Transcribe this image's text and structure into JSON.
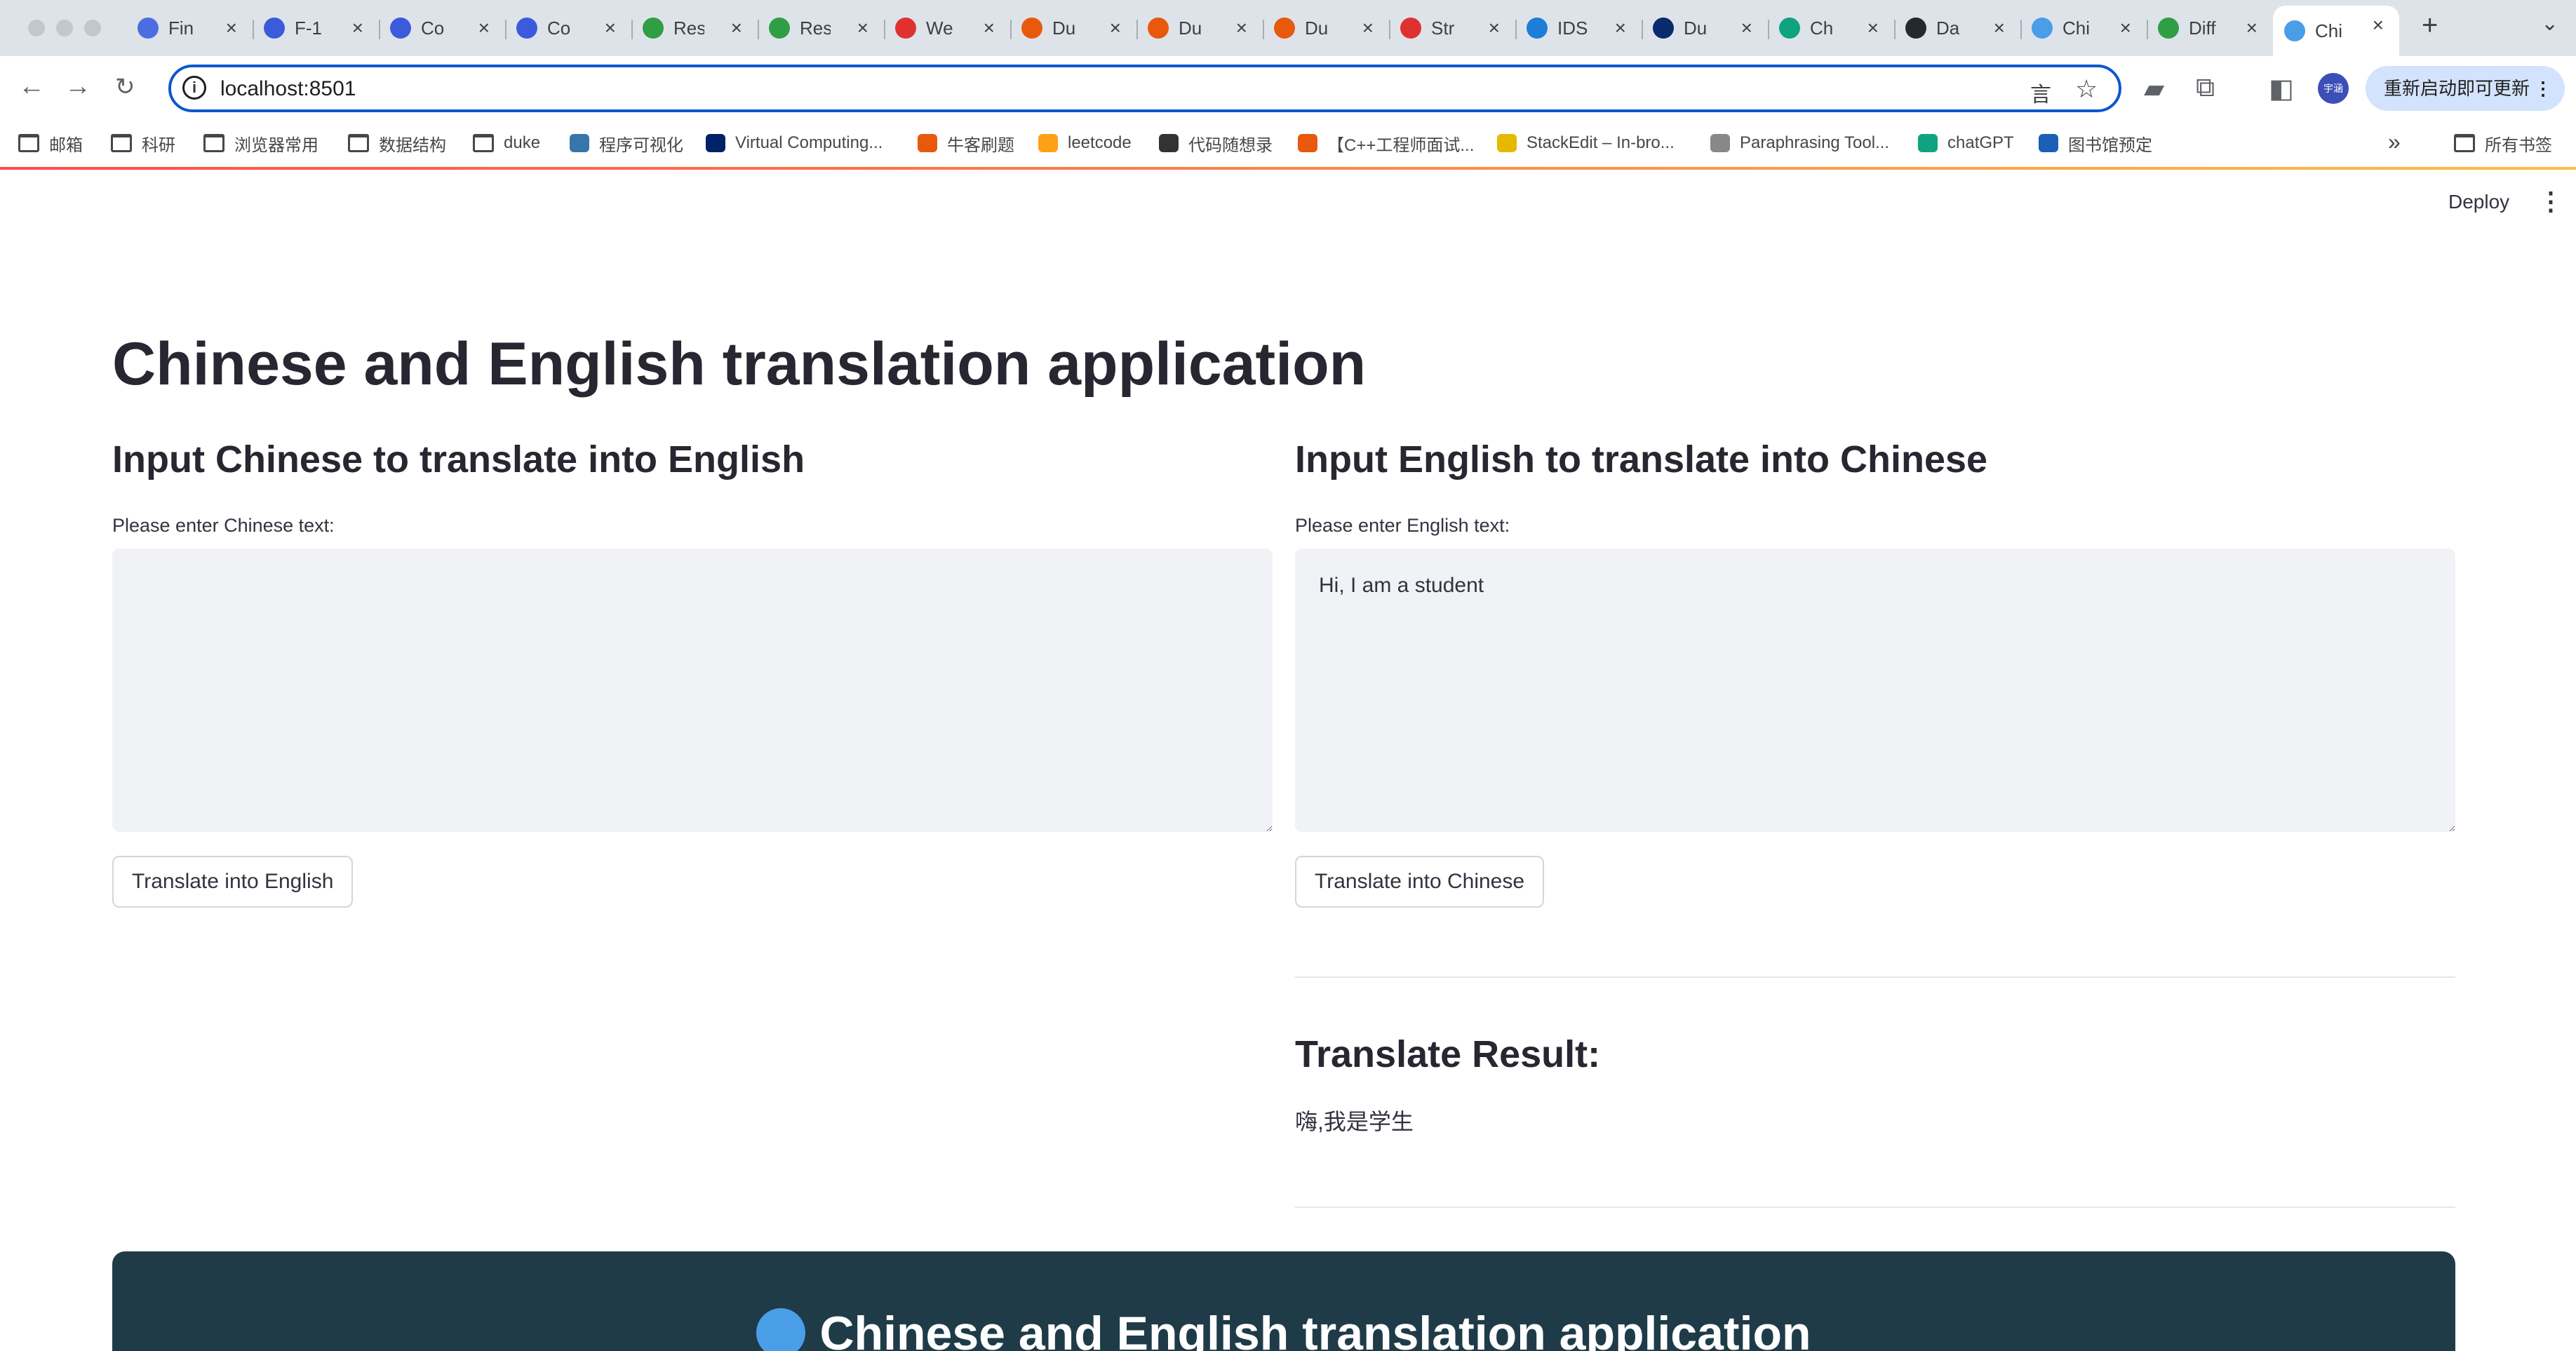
{
  "browser": {
    "tabs": [
      {
        "label": "Fin",
        "favicon": "globe-icon",
        "color": "#4a6ee0"
      },
      {
        "label": "F-1",
        "favicon": "target-icon",
        "color": "#3b5bdb"
      },
      {
        "label": "Co",
        "favicon": "course-icon",
        "color": "#3b5bdb"
      },
      {
        "label": "Co",
        "favicon": "course-icon",
        "color": "#3b5bdb"
      },
      {
        "label": "Res",
        "favicon": "bird-icon",
        "color": "#2f9e44"
      },
      {
        "label": "Res",
        "favicon": "bird-icon",
        "color": "#2f9e44"
      },
      {
        "label": "We",
        "favicon": "web-icon",
        "color": "#e03131"
      },
      {
        "label": "Du",
        "favicon": "gitlab-icon",
        "color": "#e8590c"
      },
      {
        "label": "Du",
        "favicon": "gitlab-icon",
        "color": "#e8590c"
      },
      {
        "label": "Du",
        "favicon": "gitlab-icon",
        "color": "#e8590c"
      },
      {
        "label": "Str",
        "favicon": "streamlit-icon",
        "color": "#e03131"
      },
      {
        "label": "IDS",
        "favicon": "doc-icon",
        "color": "#1c7ed6"
      },
      {
        "label": "Du",
        "favicon": "duke-icon",
        "color": "#0b2a6e"
      },
      {
        "label": "Ch",
        "favicon": "chatgpt-icon",
        "color": "#10a37f"
      },
      {
        "label": "Da",
        "favicon": "github-icon",
        "color": "#24292f"
      },
      {
        "label": "Chi",
        "favicon": "globe-icon",
        "color": "#4a9ee8"
      },
      {
        "label": "Diff",
        "favicon": "diff-icon",
        "color": "#2f9e44"
      },
      {
        "label": "Chi",
        "favicon": "globe-icon",
        "color": "#4a9ee8"
      }
    ],
    "url": "localhost:8501",
    "update_button": "重新启动即可更新",
    "profile": "宇涵"
  },
  "bookmarks": [
    {
      "label": "邮箱",
      "icon": "folder-icon"
    },
    {
      "label": "科研",
      "icon": "folder-icon"
    },
    {
      "label": "浏览器常用",
      "icon": "folder-icon"
    },
    {
      "label": "数据结构",
      "icon": "folder-icon"
    },
    {
      "label": "duke",
      "icon": "folder-icon"
    },
    {
      "label": "程序可视化",
      "icon": "python-icon"
    },
    {
      "label": "Virtual Computing...",
      "icon": "vcm-icon"
    },
    {
      "label": "牛客刷题",
      "icon": "nowcoder-icon"
    },
    {
      "label": "leetcode",
      "icon": "leetcode-icon"
    },
    {
      "label": "代码随想录",
      "icon": "code-icon"
    },
    {
      "label": "【C++工程师面试...",
      "icon": "nowcoder-icon"
    },
    {
      "label": "StackEdit – In-bro...",
      "icon": "stackedit-icon"
    },
    {
      "label": "Paraphrasing Tool...",
      "icon": "quill-icon"
    },
    {
      "label": "chatGPT",
      "icon": "chatgpt-icon"
    },
    {
      "label": "图书馆预定",
      "icon": "library-icon"
    }
  ],
  "all_bookmarks": "所有书签",
  "header": {
    "deploy": "Deploy"
  },
  "main": {
    "title": "Chinese and English translation application",
    "left": {
      "heading": "Input Chinese to translate into English",
      "label": "Please enter Chinese text:",
      "value": "",
      "button": "Translate into English"
    },
    "right": {
      "heading": "Input English to translate into Chinese",
      "label": "Please enter English text:",
      "value": "Hi, I am a student",
      "button": "Translate into Chinese"
    },
    "result": {
      "heading": "Translate Result:",
      "text": "嗨,我是学生"
    },
    "footer_title": "Chinese and English translation application"
  }
}
